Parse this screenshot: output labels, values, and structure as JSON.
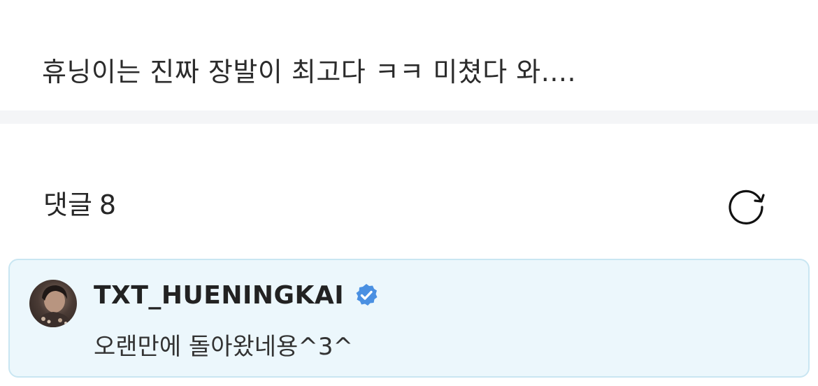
{
  "post": {
    "text": "휴닝이는 진짜 장발이 최고다 ㅋㅋ 미쳤다 와...."
  },
  "comments": {
    "title": "댓글",
    "count": "8",
    "refresh_icon": "refresh-icon"
  },
  "comment_items": [
    {
      "author": "TXT_HUENINGKAI",
      "verified": true,
      "text": "오랜만에 돌아왔네용^3^"
    }
  ],
  "colors": {
    "card_bg": "#ecf7fc",
    "card_border": "#c9e6f2",
    "verified_badge": "#4a90e2",
    "divider": "#f4f5f7"
  }
}
